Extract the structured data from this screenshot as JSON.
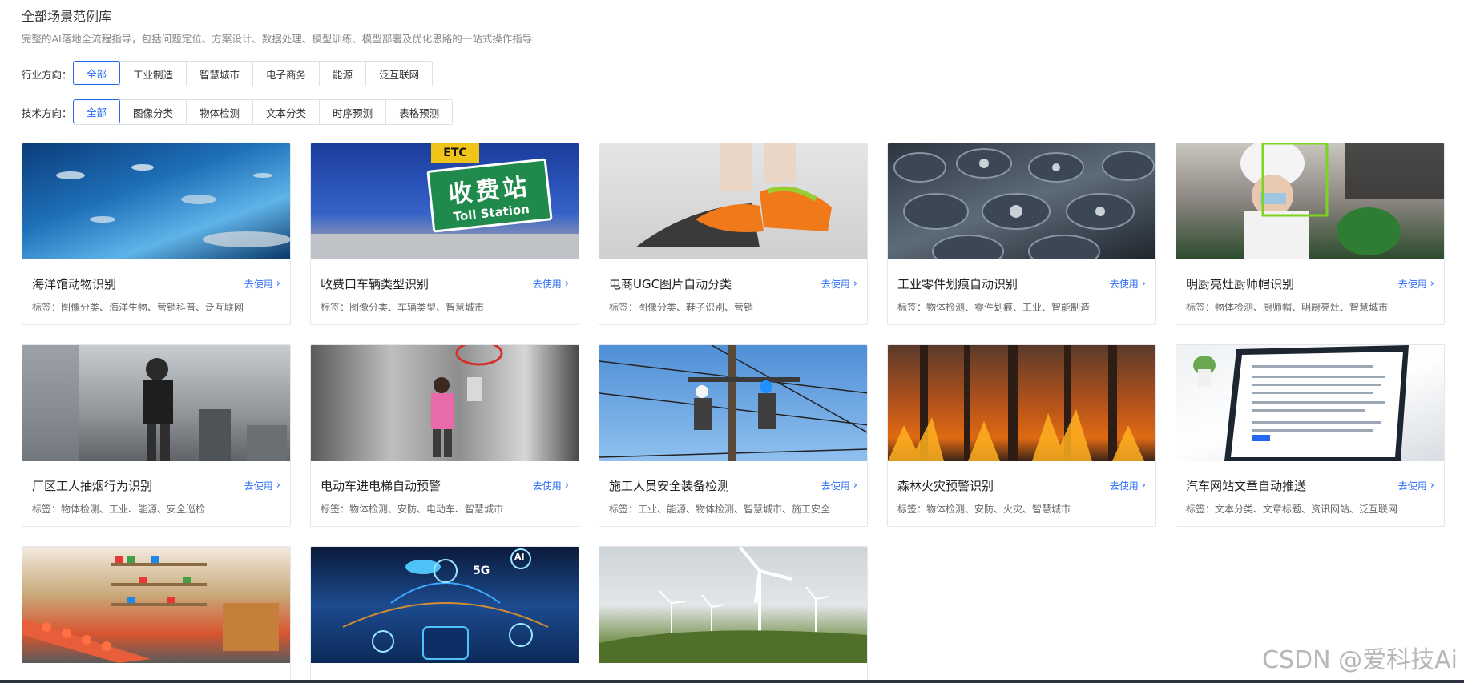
{
  "page": {
    "title": "全部场景范例库",
    "subtitle": "完整的AI落地全流程指导，包括问题定位、方案设计、数据处理、模型训练、模型部署及优化思路的一站式操作指导"
  },
  "filters": {
    "industry": {
      "label": "行业方向：",
      "options": [
        "全部",
        "工业制造",
        "智慧城市",
        "电子商务",
        "能源",
        "泛互联网"
      ],
      "selected": "全部"
    },
    "tech": {
      "label": "技术方向：",
      "options": [
        "全部",
        "图像分类",
        "物体检测",
        "文本分类",
        "时序预测",
        "表格预测"
      ],
      "selected": "全部"
    }
  },
  "cards": [
    {
      "title": "海洋馆动物识别",
      "link": "去使用",
      "tags": "标签：图像分类、海洋生物、营销科普、泛互联网",
      "image": "aquarium-fish"
    },
    {
      "title": "收费口车辆类型识别",
      "link": "去使用",
      "tags": "标签：图像分类、车辆类型、智慧城市",
      "image": "toll-station-sign"
    },
    {
      "title": "电商UGC图片自动分类",
      "link": "去使用",
      "tags": "标签：图像分类、鞋子识别、营销",
      "image": "sneakers"
    },
    {
      "title": "工业零件划痕自动识别",
      "link": "去使用",
      "tags": "标签：物体检测、零件划痕、工业、智能制造",
      "image": "industrial-parts"
    },
    {
      "title": "明厨亮灶厨师帽识别",
      "link": "去使用",
      "tags": "标签：物体检测、厨师帽、明厨亮灶、智慧城市",
      "image": "chef-kitchen"
    },
    {
      "title": "厂区工人抽烟行为识别",
      "link": "去使用",
      "tags": "标签：物体检测、工业、能源、安全巡检",
      "image": "worker-smoking"
    },
    {
      "title": "电动车进电梯自动预警",
      "link": "去使用",
      "tags": "标签：物体检测、安防、电动车、智慧城市",
      "image": "elevator-ebike"
    },
    {
      "title": "施工人员安全装备检测",
      "link": "去使用",
      "tags": "标签：工业、能源、物体检测、智慧城市、施工安全",
      "image": "power-line-workers"
    },
    {
      "title": "森林火灾预警识别",
      "link": "去使用",
      "tags": "标签：物体检测、安防、火灾、智慧城市",
      "image": "forest-fire"
    },
    {
      "title": "汽车网站文章自动推送",
      "link": "去使用",
      "tags": "标签：文本分类、文章标题、资讯网站、泛互联网",
      "image": "article-screen"
    },
    {
      "title": "",
      "link": "",
      "tags": "",
      "image": "retail-store"
    },
    {
      "title": "",
      "link": "",
      "tags": "",
      "image": "smart-car-5g"
    },
    {
      "title": "",
      "link": "",
      "tags": "",
      "image": "wind-turbines"
    }
  ],
  "overlay_images": {
    "toll_sign_top": "ETC",
    "toll_sign_main": "收费站",
    "toll_sign_en": "Toll Station",
    "car_5g": "5G",
    "car_ai": "AI"
  },
  "watermark": "CSDN @爱科技Ai",
  "colors": {
    "accent": "#2468f2",
    "border": "#dcdfe6",
    "text": "#333333",
    "muted": "#888888"
  }
}
